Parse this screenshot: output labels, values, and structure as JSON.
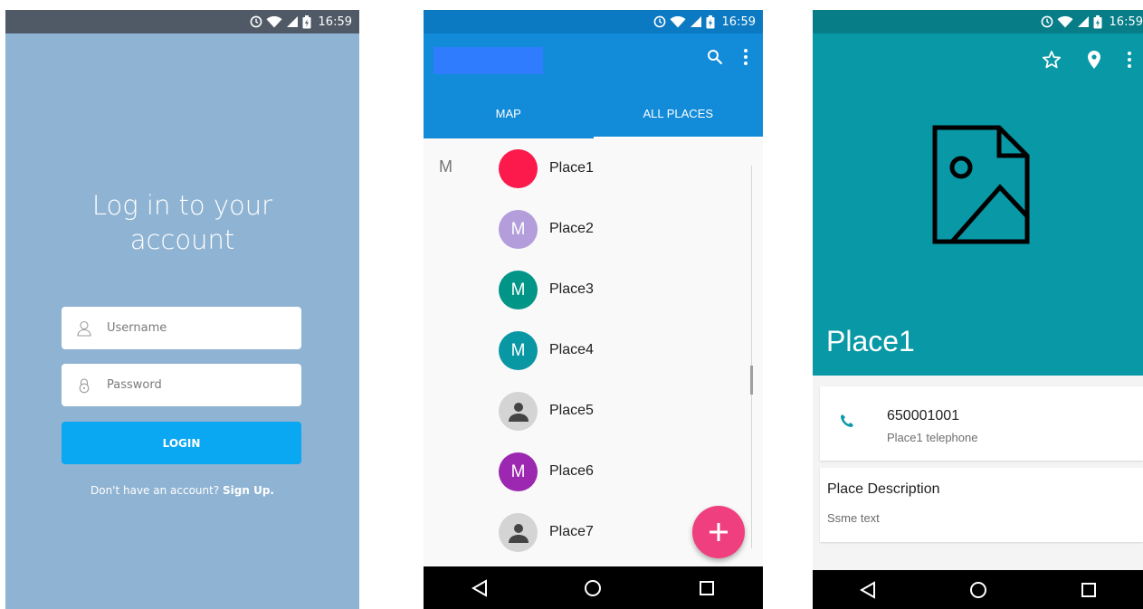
{
  "status_bar": {
    "time": "16:59"
  },
  "login": {
    "title_line1": "Log in to your",
    "title_line2": "account",
    "username_placeholder": "Username",
    "password_placeholder": "Password",
    "login_label": "LOGIN",
    "signup_prompt": "Don't have an account?",
    "signup_link": "Sign Up."
  },
  "list": {
    "tabs": [
      "MAP",
      "ALL PLACES"
    ],
    "active_tab": "ALL PLACES",
    "section_letter": "M",
    "places": [
      {
        "name": "Place1",
        "avatar": "",
        "color": "#fb1a4b"
      },
      {
        "name": "Place2",
        "avatar": "M",
        "color": "#b39ddb"
      },
      {
        "name": "Place3",
        "avatar": "M",
        "color": "#009587"
      },
      {
        "name": "Place4",
        "avatar": "M",
        "color": "#0a97a4"
      },
      {
        "name": "Place5",
        "avatar": "person-icon",
        "color": "#d4d4d4"
      },
      {
        "name": "Place6",
        "avatar": "M",
        "color": "#9c27b0"
      },
      {
        "name": "Place7",
        "avatar": "person-icon",
        "color": "#d4d4d4"
      }
    ],
    "fab_icon": "plus-icon"
  },
  "detail": {
    "title": "Place1",
    "phone_number": "650001001",
    "phone_label": "Place1 telephone",
    "description_title": "Place Description",
    "description_text": "Ssme text"
  },
  "colors": {
    "login_bg": "#8fb3d2",
    "login_button": "#0aa7f2",
    "list_appbar": "#128bd8",
    "fab": "#ef3f7e",
    "detail_header": "#0898a6"
  }
}
